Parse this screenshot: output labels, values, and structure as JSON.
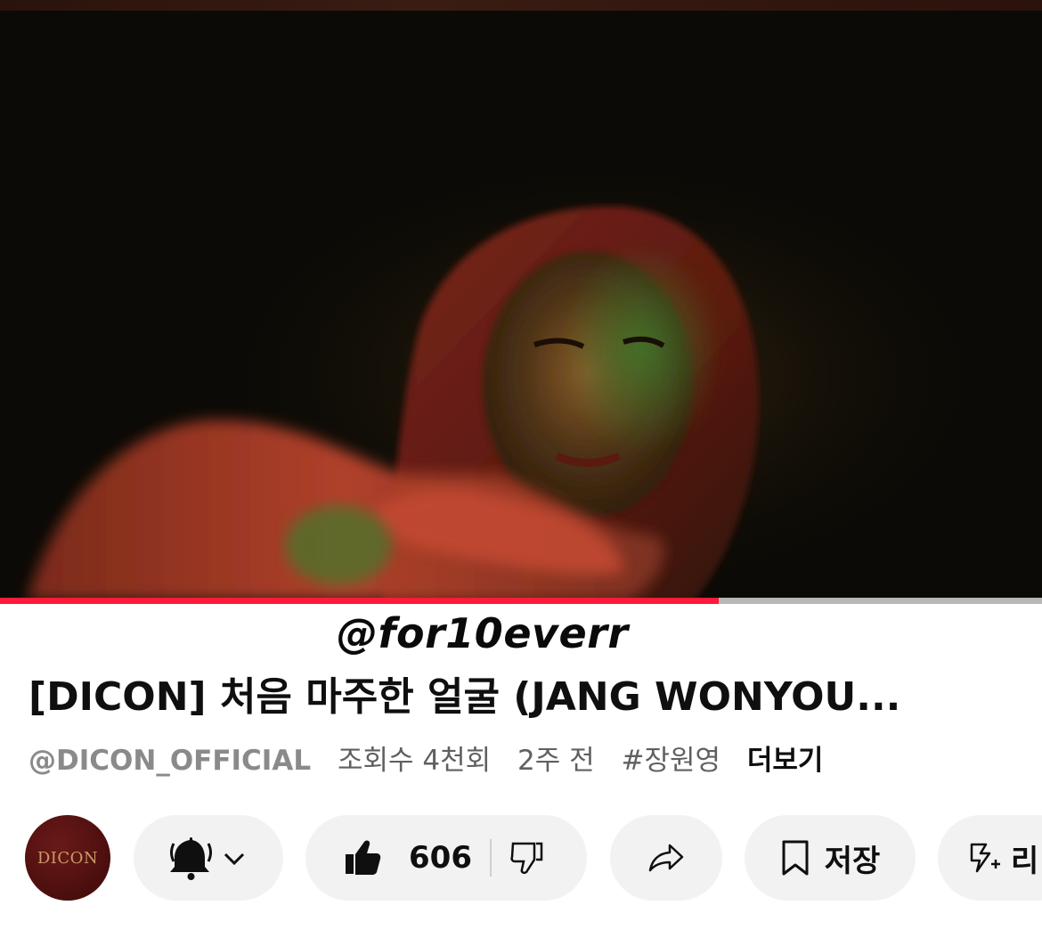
{
  "watermark": "@for10everr",
  "video": {
    "title": "[DICON] 처음 마주한 얼굴 (JANG WONYOU...",
    "progress_fraction": 0.69
  },
  "meta": {
    "channel": "@DICON_OFFICIAL",
    "views": "조회수 4천회",
    "age": "2주 전",
    "hashtag": "#장원영",
    "more": "더보기"
  },
  "channel_avatar": {
    "logo_text": "DICON"
  },
  "actions": {
    "like_count": "606",
    "save_label": "저장",
    "remix_label_partial": "리"
  },
  "colors": {
    "progress": "#ff1a3a",
    "pill_bg": "#f2f2f2",
    "avatar": "#5a1413"
  }
}
